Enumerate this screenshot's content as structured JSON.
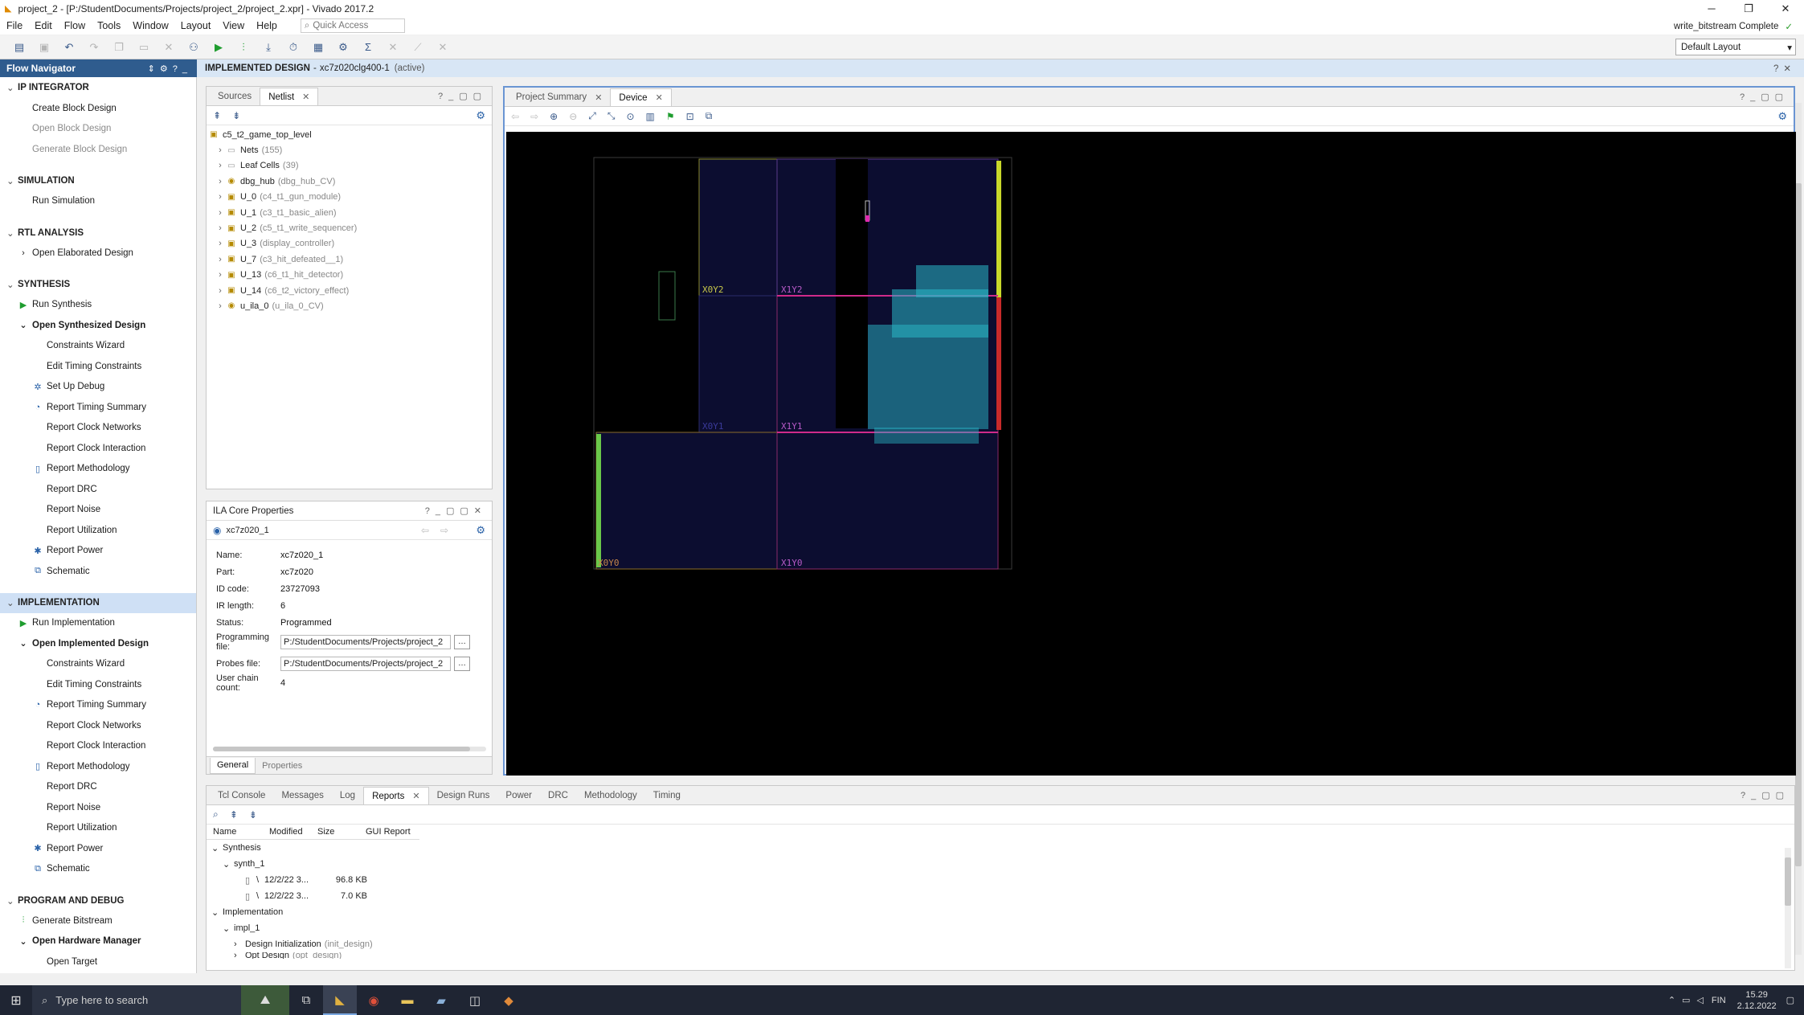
{
  "window": {
    "title": "project_2 - [P:/StudentDocuments/Projects/project_2/project_2.xpr] - Vivado 2017.2",
    "controls": [
      "─",
      "❐",
      "✕"
    ]
  },
  "menu": {
    "items": [
      "File",
      "Edit",
      "Flow",
      "Tools",
      "Window",
      "Layout",
      "View",
      "Help"
    ],
    "quick_access": "Quick Access"
  },
  "status": {
    "text": "write_bitstream Complete"
  },
  "layout": {
    "selected": "Default Layout"
  },
  "flow_navigator": {
    "title": "Flow Navigator",
    "ip": {
      "title": "IP INTEGRATOR",
      "items": [
        "Create Block Design",
        "Open Block Design",
        "Generate Block Design"
      ]
    },
    "sim": {
      "title": "SIMULATION",
      "items": [
        "Run Simulation"
      ]
    },
    "rtl": {
      "title": "RTL ANALYSIS",
      "items": [
        "Open Elaborated Design"
      ]
    },
    "synth": {
      "title": "SYNTHESIS",
      "run": "Run Synthesis",
      "open": "Open Synthesized Design",
      "items": [
        "Constraints Wizard",
        "Edit Timing Constraints",
        "Set Up Debug",
        "Report Timing Summary",
        "Report Clock Networks",
        "Report Clock Interaction",
        "Report Methodology",
        "Report DRC",
        "Report Noise",
        "Report Utilization",
        "Report Power",
        "Schematic"
      ]
    },
    "impl": {
      "title": "IMPLEMENTATION",
      "run": "Run Implementation",
      "open": "Open Implemented Design",
      "items": [
        "Constraints Wizard",
        "Edit Timing Constraints",
        "Report Timing Summary",
        "Report Clock Networks",
        "Report Clock Interaction",
        "Report Methodology",
        "Report DRC",
        "Report Noise",
        "Report Utilization",
        "Report Power",
        "Schematic"
      ]
    },
    "prog": {
      "title": "PROGRAM AND DEBUG",
      "items": [
        "Generate Bitstream",
        "Open Hardware Manager",
        "Open Target"
      ]
    }
  },
  "impl_bar": {
    "label": "IMPLEMENTED DESIGN",
    "part": "xc7z020clg400-1",
    "state": "(active)"
  },
  "netlist_panel": {
    "tabs": [
      "Sources",
      "Netlist"
    ],
    "root": "c5_t2_game_top_level",
    "nodes": [
      {
        "name": "Nets",
        "detail": "(155)"
      },
      {
        "name": "Leaf Cells",
        "detail": "(39)"
      },
      {
        "name": "dbg_hub",
        "detail": "(dbg_hub_CV)"
      },
      {
        "name": "U_0",
        "detail": "(c4_t1_gun_module)"
      },
      {
        "name": "U_1",
        "detail": "(c3_t1_basic_alien)"
      },
      {
        "name": "U_2",
        "detail": "(c5_t1_write_sequencer)"
      },
      {
        "name": "U_3",
        "detail": "(display_controller)"
      },
      {
        "name": "U_7",
        "detail": "(c3_hit_defeated__1)"
      },
      {
        "name": "U_13",
        "detail": "(c6_t1_hit_detector)"
      },
      {
        "name": "U_14",
        "detail": "(c6_t2_victory_effect)"
      },
      {
        "name": "u_ila_0",
        "detail": "(u_ila_0_CV)"
      }
    ]
  },
  "ila_panel": {
    "title": "ILA Core Properties",
    "device": "xc7z020_1",
    "props": [
      {
        "k": "Name:",
        "v": "xc7z020_1"
      },
      {
        "k": "Part:",
        "v": "xc7z020"
      },
      {
        "k": "ID code:",
        "v": "23727093"
      },
      {
        "k": "IR length:",
        "v": "6"
      },
      {
        "k": "Status:",
        "v": "Programmed"
      }
    ],
    "programming_file_label": "Programming file:",
    "programming_file": "P:/StudentDocuments/Projects/project_2",
    "probes_file_label": "Probes file:",
    "probes_file": "P:/StudentDocuments/Projects/project_2",
    "user_chain_label": "User chain count:",
    "user_chain": "4",
    "tabs": [
      "General",
      "Properties"
    ]
  },
  "device_panel": {
    "tabs": [
      "Project Summary",
      "Device"
    ],
    "regions": [
      "X0Y2",
      "X1Y2",
      "X0Y1",
      "X1Y1",
      "X0Y0",
      "X1Y0"
    ]
  },
  "bottom_panel": {
    "tabs": [
      "Tcl Console",
      "Messages",
      "Log",
      "Reports",
      "Design Runs",
      "Power",
      "DRC",
      "Methodology",
      "Timing"
    ],
    "columns": [
      "Name",
      "Modified",
      "Size",
      "GUI Report"
    ],
    "rows": [
      {
        "name": "Synthesis",
        "modified": "",
        "size": ""
      },
      {
        "name": "synth_1",
        "modified": "",
        "size": ""
      },
      {
        "name": "\\",
        "modified": "12/2/22 3...",
        "size": "96.8 KB"
      },
      {
        "name": "\\",
        "modified": "12/2/22 3...",
        "size": "7.0 KB"
      },
      {
        "name": "Implementation",
        "modified": "",
        "size": ""
      },
      {
        "name": "impl_1",
        "modified": "",
        "size": ""
      },
      {
        "name": "Design Initialization",
        "detail": "(init_design)",
        "modified": "",
        "size": ""
      },
      {
        "name": "Opt Design",
        "detail": "(opt_design)",
        "modified": "",
        "size": ""
      }
    ]
  },
  "taskbar": {
    "search": "Type here to search",
    "lang": "FIN",
    "time": "15.29",
    "date": "2.12.2022"
  }
}
